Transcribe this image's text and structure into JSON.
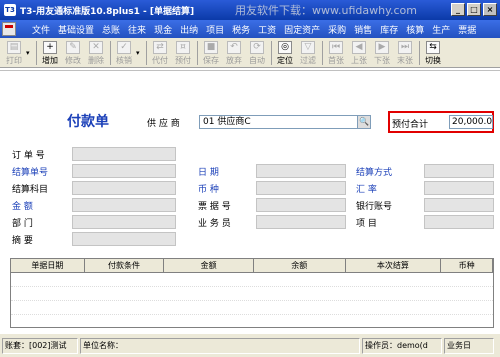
{
  "window": {
    "title": "T3-用友通标准版10.8plus1 - [单据结算]",
    "watermark": "用友软件下载：www.ufidawhy.com",
    "controls": [
      "_",
      "□",
      "×"
    ]
  },
  "menu": {
    "items": [
      "文件",
      "基础设置",
      "总账",
      "往来",
      "现金",
      "出纳",
      "项目",
      "税务",
      "工资",
      "固定资产",
      "采购",
      "销售",
      "库存",
      "核算",
      "生产",
      "票据"
    ]
  },
  "toolbar": {
    "buttons": [
      {
        "label": "打印",
        "icon": "printer-icon",
        "enabled": false
      },
      {
        "label": "增加",
        "icon": "add-icon",
        "enabled": true
      },
      {
        "label": "修改",
        "icon": "edit-icon",
        "enabled": false
      },
      {
        "label": "删除",
        "icon": "delete-icon",
        "enabled": false
      },
      {
        "label": "核销",
        "icon": "verify-icon",
        "enabled": false
      },
      {
        "label": "代付",
        "icon": "proxy-pay-icon",
        "enabled": false
      },
      {
        "label": "预付",
        "icon": "prepay-icon",
        "enabled": false
      },
      {
        "label": "保存",
        "icon": "save-icon",
        "enabled": false
      },
      {
        "label": "放弃",
        "icon": "discard-icon",
        "enabled": false
      },
      {
        "label": "自动",
        "icon": "auto-icon",
        "enabled": false
      },
      {
        "label": "定位",
        "icon": "locate-icon",
        "enabled": true
      },
      {
        "label": "过滤",
        "icon": "filter-icon",
        "enabled": false
      },
      {
        "label": "首张",
        "icon": "first-icon",
        "enabled": false
      },
      {
        "label": "上张",
        "icon": "prev-icon",
        "enabled": false
      },
      {
        "label": "下张",
        "icon": "next-icon",
        "enabled": false
      },
      {
        "label": "末张",
        "icon": "last-icon",
        "enabled": false
      },
      {
        "label": "切换",
        "icon": "switch-icon",
        "enabled": true
      }
    ]
  },
  "form": {
    "title": "付款单",
    "supplier_label": "供 应 商",
    "supplier_value": "01  供应商C",
    "prepay_label": "预付合计",
    "prepay_value": "20,000.00",
    "left_fields": [
      {
        "label": "订 单 号",
        "blue": false
      },
      {
        "label": "结算单号",
        "blue": true
      },
      {
        "label": "结算科目",
        "blue": false
      },
      {
        "label": "金     额",
        "blue": true
      },
      {
        "label": "部     门",
        "blue": false
      },
      {
        "label": "摘     要",
        "blue": false
      }
    ],
    "mid_fields": [
      {
        "label": "日     期",
        "blue": true
      },
      {
        "label": "币     种",
        "blue": true
      },
      {
        "label": "票 据 号",
        "blue": false
      },
      {
        "label": "业 务 员",
        "blue": false
      }
    ],
    "right_fields": [
      {
        "label": "结算方式",
        "blue": true
      },
      {
        "label": "汇     率",
        "blue": true
      },
      {
        "label": "银行账号",
        "blue": false
      },
      {
        "label": "项     目",
        "blue": false
      }
    ]
  },
  "grid": {
    "columns": [
      "单据日期",
      "付款条件",
      "金额",
      "余额",
      "本次结算",
      "币种"
    ]
  },
  "status": {
    "account": "账套：[002]测试",
    "unit": "单位名称：",
    "operator": "操作员：demo(d",
    "business_date": "业务日"
  }
}
